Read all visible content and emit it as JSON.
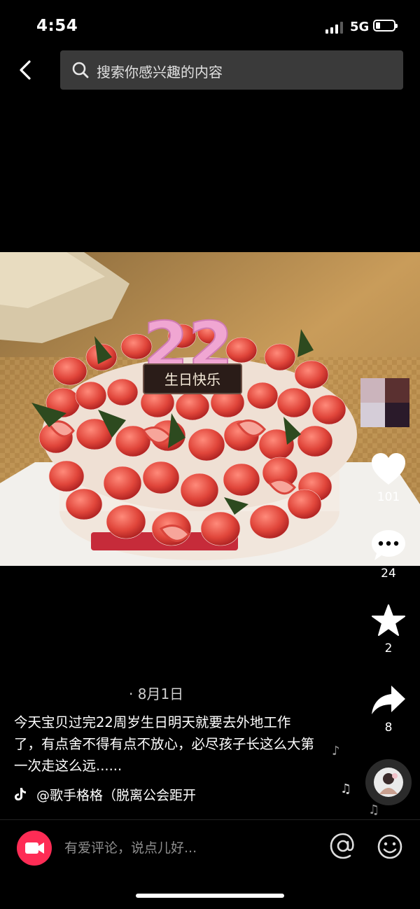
{
  "status_bar": {
    "time": "4:54",
    "network": "5G"
  },
  "search": {
    "placeholder": "搜索你感兴趣的内容"
  },
  "actions": {
    "likes": "101",
    "comments": "24",
    "favorites": "2",
    "shares": "8"
  },
  "post": {
    "date": "· 8月1日",
    "caption": "今天宝贝过完22周岁生日明天就要去外地工作了，有点舍不得有点不放心，必尽孩子长这么大第一次走这么远......",
    "author": "@歌手格格（脱离公会距开"
  },
  "cake": {
    "number_candles": "22",
    "topper_text": "生日快乐"
  },
  "comment_bar": {
    "placeholder": "有爱评论，说点儿好..."
  },
  "icons": {
    "back": "chevron-left-icon",
    "search": "search-icon",
    "like": "heart-icon",
    "comment": "comment-bubble-icon",
    "favorite": "star-icon",
    "share": "share-arrow-icon",
    "camera": "video-camera-icon",
    "mention": "at-icon",
    "emoji": "smiley-icon",
    "music": "music-note-icon"
  },
  "colors": {
    "accent": "#fe2c55",
    "search_bg": "#3a3a3a",
    "background": "#000000"
  }
}
